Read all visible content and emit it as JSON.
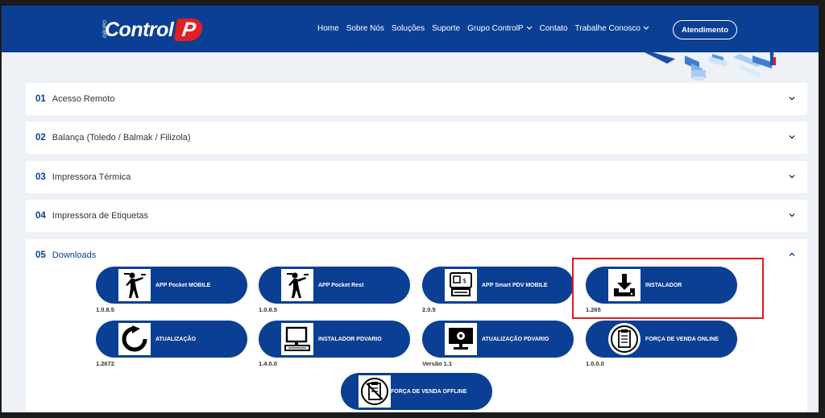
{
  "header": {
    "logo_small": "GRUPO",
    "logo_text": "Control",
    "logo_p": "P",
    "nav": [
      {
        "label": "Home",
        "has_caret": false
      },
      {
        "label": "Sobre Nós",
        "has_caret": false
      },
      {
        "label": "Soluções",
        "has_caret": false
      },
      {
        "label": "Suporte",
        "has_caret": false
      },
      {
        "label": "Grupo ControlP",
        "has_caret": true
      },
      {
        "label": "Contato",
        "has_caret": false
      },
      {
        "label": "Trabalhe Conosco",
        "has_caret": true
      }
    ],
    "cta_label": "Atendimento"
  },
  "accordion": [
    {
      "num": "01",
      "title": "Acesso Remoto",
      "open": false
    },
    {
      "num": "02",
      "title": "Balança (Toledo / Balmak / Filizola)",
      "open": false
    },
    {
      "num": "03",
      "title": "Impressora Térmica",
      "open": false
    },
    {
      "num": "04",
      "title": "Impressora de Etiquetas",
      "open": false
    },
    {
      "num": "05",
      "title": "Downloads",
      "open": true
    }
  ],
  "downloads": [
    {
      "label": "APP Pocket MOBILE",
      "version": "1.0.8.5",
      "icon": "waiter-icon"
    },
    {
      "label": "APP Pocket Rest",
      "version": "1.0.8.5",
      "icon": "waiter-icon"
    },
    {
      "label": "APP Smart PDV MOBILE",
      "version": "2.0.5",
      "icon": "pos-terminal-icon"
    },
    {
      "label": "INSTALADOR",
      "version": "1.265",
      "icon": "download-icon"
    },
    {
      "label": "ATUALIZAÇÃO",
      "version": "1.2672",
      "icon": "refresh-icon"
    },
    {
      "label": "INSTALADOR PDVARIO",
      "version": "1.4.0.0",
      "icon": "computer-icon"
    },
    {
      "label": "ATUALIZAÇÃO PDVARIO",
      "version": "Versão 1.1",
      "icon": "monitor-settings-icon"
    },
    {
      "label": "FORÇA DE VENDA ONLINE",
      "version": "1.0.0.0",
      "icon": "clipboard-list-icon"
    },
    {
      "label": "FORÇA DE VENDA OFFLINE",
      "version": "",
      "icon": "clipboard-offline-icon"
    }
  ],
  "colors": {
    "brand_blue": "#0b3f94",
    "brand_red": "#e31e24",
    "highlight": "#e3191f"
  }
}
